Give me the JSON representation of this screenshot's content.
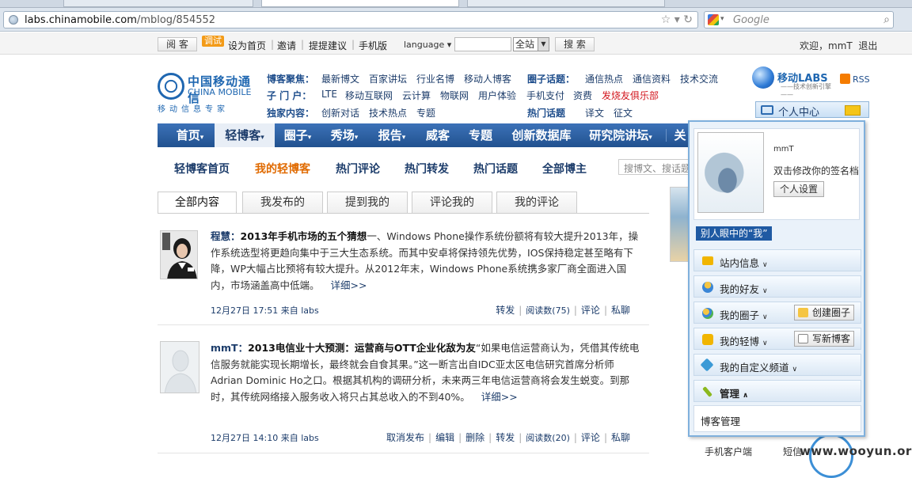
{
  "browser": {
    "url_host": "labs.chinamobile.com",
    "url_path": "/mblog/854552",
    "search_placeholder": "Google"
  },
  "topbar": {
    "visit_label": "阅 客",
    "test_badge": "调试",
    "links": [
      "设为首页",
      "邀请",
      "提提建议",
      "手机版"
    ],
    "language": "language",
    "scope": "全站",
    "search_btn": "搜 索",
    "welcome": "欢迎，mmT",
    "logout": "退出"
  },
  "logo": {
    "cn": "中国移动通信",
    "en": "CHINA MOBILE",
    "sub": "移动信息专家"
  },
  "quicklinks": {
    "r1_label": "博客聚焦：",
    "r1": [
      "最新博文",
      "百家讲坛",
      "行业名博",
      "移动人博客"
    ],
    "r1b_label": "圈子话题：",
    "r1b": [
      "通信热点",
      "通信资料",
      "技术交流"
    ],
    "r2_label": "子 门 户：",
    "r2": [
      "LTE",
      "移动互联网",
      "云计算",
      "物联网",
      "用户体验",
      "手机支付",
      "资费"
    ],
    "r2_red": "发烧友俱乐部",
    "r3_label": "独家内容：",
    "r3": [
      "创新对话",
      "技术热点",
      "专题"
    ],
    "r3b_label": "热门话题",
    "r3b": [
      "译文",
      "征文"
    ]
  },
  "labs": {
    "name": "移动LABS",
    "slogan": "——技术创新引擎——",
    "rss": "RSS",
    "personal_center": "个人中心"
  },
  "mainnav": [
    "首页",
    "轻博客",
    "圈子",
    "秀场",
    "报告",
    "威客",
    "专题",
    "创新数据库",
    "研究院讲坛",
    "关"
  ],
  "subnav": {
    "items": [
      "轻博客首页",
      "我的轻博客",
      "热门评论",
      "热门转发",
      "热门话题",
      "全部博主"
    ],
    "search_placeholder": "搜博文、搜话题"
  },
  "tabs": [
    "全部内容",
    "我发布的",
    "提到我的",
    "评论我的",
    "我的评论"
  ],
  "posts": [
    {
      "author": "程慧：",
      "title": "2013年手机市场的五个猜想",
      "body": "一、Windows Phone操作系统份额将有较大提升2013年，操作系统选型将更趋向集中于三大生态系统。而其中安卓将保持领先优势，IOS保持稳定甚至略有下降，WP大幅占比预将有较大提升。从2012年末，Windows Phone系统携多家厂商全面进入国内，市场涵盖高中低端。",
      "more": "详细>>",
      "time": "12月27日 17:51",
      "source": "来自 labs",
      "actions": [
        "转发",
        "阅读数(75)",
        "评论",
        "私聊"
      ]
    },
    {
      "author": "mmT：",
      "title": "2013电信业十大预测：运营商与OTT企业化敌为友",
      "body": "“如果电信运营商认为，凭借其传统电信服务就能实现长期增长，最终就会自食其果。”这一断言出自IDC亚太区电信研究首席分析师Adrian Dominic Ho之口。根据其机构的调研分析，未来两三年电信运营商将会发生蜕变。到那时，其传统网络接入服务收入将只占其总收入的不到40%。",
      "more": "详细>>",
      "time": "12月27日 14:10",
      "source": "来自 labs",
      "actions": [
        "取消发布",
        "编辑",
        "删除",
        "转发",
        "阅读数(20)",
        "评论",
        "私聊"
      ]
    }
  ],
  "panel": {
    "name": "mmT",
    "signature": "双击修改你的签名档",
    "settings": "个人设置",
    "others_view": "别人眼中的“我”",
    "rows": [
      {
        "label": "站内信息",
        "button": ""
      },
      {
        "label": "我的好友",
        "button": ""
      },
      {
        "label": "我的圈子",
        "button": "创建圈子"
      },
      {
        "label": "我的轻博",
        "button": "写新博客"
      },
      {
        "label": "我的自定义频道",
        "button": ""
      },
      {
        "label": "管理",
        "button": ""
      }
    ],
    "admin_item": "博客管理"
  },
  "side": {
    "client": "手机客户端",
    "letter": "短信"
  },
  "watermark": "www.wooyun.org",
  "colors": {
    "nav_blue": "#2a5d9f",
    "link_blue": "#1d3d6b",
    "orange": "#e06a00",
    "red": "#d2161e"
  }
}
